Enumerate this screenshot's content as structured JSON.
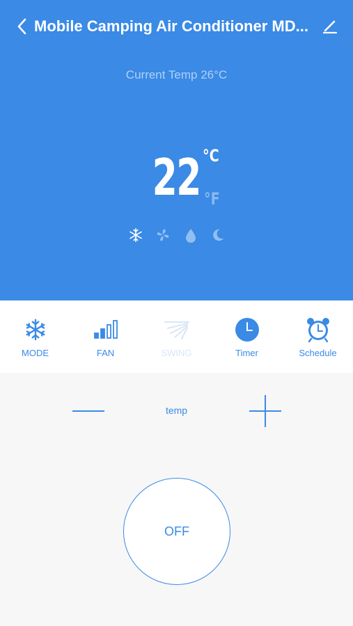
{
  "header": {
    "title": "Mobile Camping Air Conditioner MD...",
    "back_icon": "chevron-left-icon",
    "edit_icon": "pencil-icon"
  },
  "status": {
    "current_temp": "Current Temp 26°C",
    "set_temp": "22",
    "unit_celsius": "°C",
    "unit_fahrenheit": "°F",
    "active_unit": "°C"
  },
  "mode_indicators": [
    {
      "name": "snowflake-icon",
      "active": true
    },
    {
      "name": "fan-icon",
      "active": false
    },
    {
      "name": "droplet-icon",
      "active": false
    },
    {
      "name": "moon-icon",
      "active": false
    }
  ],
  "toolbar": {
    "mode": "MODE",
    "fan": "FAN",
    "swing": "SWING",
    "timer": "Timer",
    "schedule": "Schedule"
  },
  "controls": {
    "temp_label": "temp",
    "power_label": "OFF"
  },
  "colors": {
    "primary": "#3a8ae6",
    "background": "#f7f7f7",
    "panel": "#ffffff"
  }
}
